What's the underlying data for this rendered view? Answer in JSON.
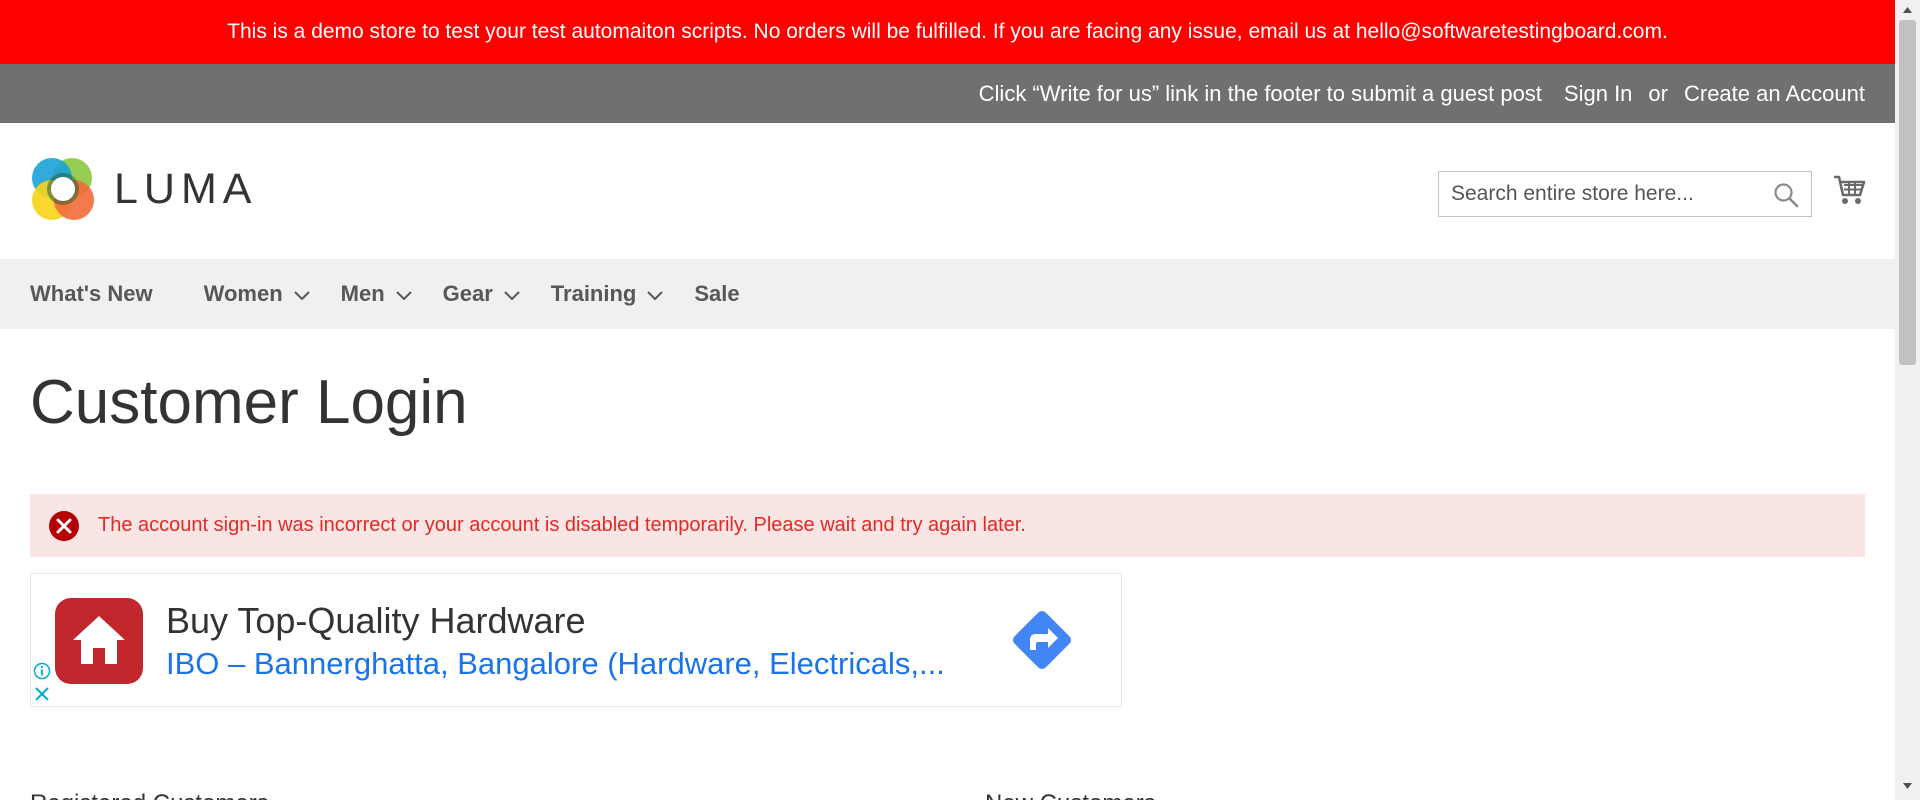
{
  "demo_notice": "This is a demo store to test your test automaiton scripts. No orders will be fulfilled. If you are facing any issue, email us at hello@softwaretestingboard.com.",
  "header_links": {
    "promo": "Click “Write for us” link in the footer to submit a guest post",
    "sign_in": "Sign In",
    "or": "or",
    "create_account": "Create an Account"
  },
  "logo": {
    "text": "LUMA"
  },
  "search": {
    "placeholder": "Search entire store here..."
  },
  "nav": {
    "items": [
      {
        "label": "What's New",
        "dropdown": false
      },
      {
        "label": "Women",
        "dropdown": true
      },
      {
        "label": "Men",
        "dropdown": true
      },
      {
        "label": "Gear",
        "dropdown": true
      },
      {
        "label": "Training",
        "dropdown": true
      },
      {
        "label": "Sale",
        "dropdown": false
      }
    ]
  },
  "page_title": "Customer Login",
  "error_message": "The account sign-in was incorrect or your account is disabled temporarily. Please wait and try again later.",
  "ad": {
    "title": "Buy Top-Quality Hardware",
    "subtitle": "IBO – Bannerghatta, Bangalore (Hardware, Electricals,..."
  },
  "below_fold": {
    "left_heading": "Registered Customers",
    "right_heading": "New Customers"
  },
  "colors": {
    "demo_bar": "#ff0000",
    "header_links_bar": "#6e716e",
    "nav_bar": "#f0f0f0",
    "error_bg": "#fae5e5",
    "error_text": "#e02b27",
    "ad_link": "#1a73e8"
  },
  "icons": [
    "luma-logo-icon",
    "search-icon",
    "cart-icon",
    "chevron-down-icon",
    "error-x-icon",
    "house-icon",
    "directions-arrow-icon",
    "ad-info-icon",
    "ad-close-icon"
  ]
}
